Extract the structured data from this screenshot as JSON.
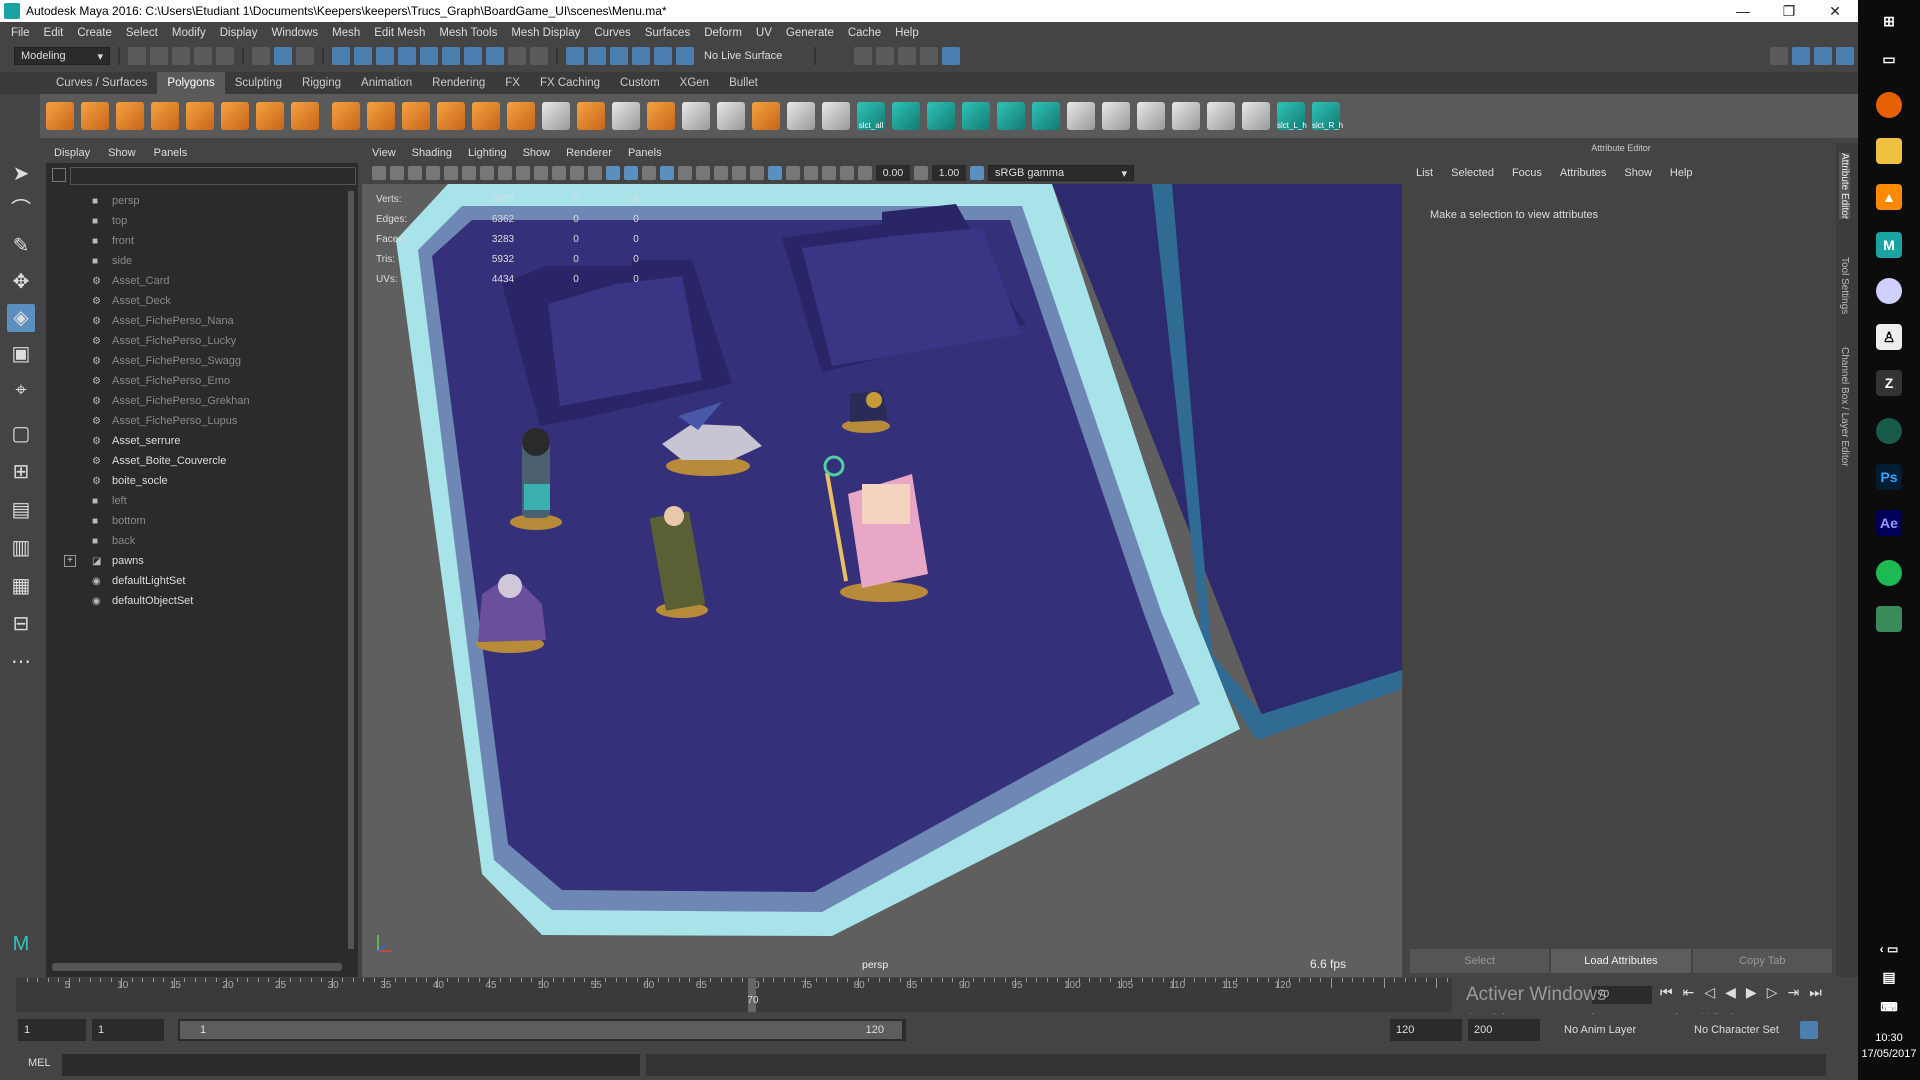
{
  "window": {
    "title": "Autodesk Maya 2016: C:\\Users\\Etudiant 1\\Documents\\Keepers\\keepers\\Trucs_Graph\\BoardGame_UI\\scenes\\Menu.ma*",
    "minimize": "—",
    "maximize": "❐",
    "close": "✕"
  },
  "menubar": [
    "File",
    "Edit",
    "Create",
    "Select",
    "Modify",
    "Display",
    "Windows",
    "Mesh",
    "Edit Mesh",
    "Mesh Tools",
    "Mesh Display",
    "Curves",
    "Surfaces",
    "Deform",
    "UV",
    "Generate",
    "Cache",
    "Help"
  ],
  "statusline": {
    "mode": "Modeling",
    "live_surface": "No Live Surface"
  },
  "shelf": {
    "tabs": [
      "Curves / Surfaces",
      "Polygons",
      "Sculpting",
      "Rigging",
      "Animation",
      "Rendering",
      "FX",
      "FX Caching",
      "Custom",
      "XGen",
      "Bullet"
    ],
    "active_tab": "Polygons",
    "custom_labels": [
      "slct_all",
      "slct_L_h",
      "slct_R_h"
    ]
  },
  "outliner": {
    "menu": [
      "Display",
      "Show",
      "Panels"
    ],
    "items": [
      {
        "label": "persp",
        "icon": "camera-icon",
        "dim": true
      },
      {
        "label": "top",
        "icon": "camera-icon",
        "dim": true
      },
      {
        "label": "front",
        "icon": "camera-icon",
        "dim": true
      },
      {
        "label": "side",
        "icon": "camera-icon",
        "dim": true
      },
      {
        "label": "Asset_Card",
        "icon": "group-icon",
        "dim": true
      },
      {
        "label": "Asset_Deck",
        "icon": "group-icon",
        "dim": true
      },
      {
        "label": "Asset_FichePerso_Nana",
        "icon": "group-icon",
        "dim": true
      },
      {
        "label": "Asset_FichePerso_Lucky",
        "icon": "group-icon",
        "dim": true
      },
      {
        "label": "Asset_FichePerso_Swagg",
        "icon": "group-icon",
        "dim": true
      },
      {
        "label": "Asset_FichePerso_Emo",
        "icon": "group-icon",
        "dim": true
      },
      {
        "label": "Asset_FichePerso_Grekhan",
        "icon": "group-icon",
        "dim": true
      },
      {
        "label": "Asset_FichePerso_Lupus",
        "icon": "group-icon",
        "dim": true
      },
      {
        "label": "Asset_serrure",
        "icon": "group-icon",
        "dim": false
      },
      {
        "label": "Asset_Boite_Couvercle",
        "icon": "group-icon",
        "dim": false
      },
      {
        "label": "boite_socle",
        "icon": "group-icon",
        "dim": false
      },
      {
        "label": "left",
        "icon": "camera-icon",
        "dim": true
      },
      {
        "label": "bottom",
        "icon": "camera-icon",
        "dim": true
      },
      {
        "label": "back",
        "icon": "camera-icon",
        "dim": true
      },
      {
        "label": "pawns",
        "icon": "layer-icon",
        "dim": false,
        "expandable": true
      },
      {
        "label": "defaultLightSet",
        "icon": "set-icon",
        "dim": false
      },
      {
        "label": "defaultObjectSet",
        "icon": "set-icon",
        "dim": false
      }
    ]
  },
  "viewport": {
    "menu": [
      "View",
      "Shading",
      "Lighting",
      "Show",
      "Renderer",
      "Panels"
    ],
    "exposure": "0.00",
    "gamma": "1.00",
    "color_space": "sRGB gamma",
    "camera": "persp",
    "fps": "6.6 fps",
    "hud": [
      {
        "label": "Verts:",
        "v1": "3070",
        "v2": "0",
        "v3": "0"
      },
      {
        "label": "Edges:",
        "v1": "6362",
        "v2": "0",
        "v3": "0"
      },
      {
        "label": "Faces:",
        "v1": "3283",
        "v2": "0",
        "v3": "0"
      },
      {
        "label": "Tris:",
        "v1": "5932",
        "v2": "0",
        "v3": "0"
      },
      {
        "label": "UVs:",
        "v1": "4434",
        "v2": "0",
        "v3": "0"
      }
    ],
    "colors": {
      "tray": "#35307a",
      "rim": "#a8e3ea",
      "background": "#5f5f5f"
    }
  },
  "attribute_editor": {
    "header": "Attribute Editor",
    "menu": [
      "List",
      "Selected",
      "Focus",
      "Attributes",
      "Show",
      "Help"
    ],
    "message": "Make a selection to view attributes",
    "buttons": [
      "Select",
      "Load Attributes",
      "Copy Tab"
    ],
    "side_tabs": [
      "Attribute Editor",
      "Tool Settings",
      "Channel Box / Layer Editor"
    ]
  },
  "timeline": {
    "ticks": [
      "5",
      "10",
      "15",
      "20",
      "25",
      "30",
      "35",
      "40",
      "45",
      "50",
      "55",
      "60",
      "65",
      "70",
      "75",
      "80",
      "85",
      "90",
      "95",
      "100",
      "105",
      "110",
      "115",
      "120"
    ],
    "current_frame": "70",
    "frame_field": "70"
  },
  "range": {
    "start": "1",
    "playback_start": "1",
    "range_start": "1",
    "range_end": "120",
    "playback_end": "120",
    "end": "200",
    "anim_layer": "No Anim Layer",
    "character_set": "No Character Set"
  },
  "command_line": {
    "label": "MEL"
  },
  "watermark": {
    "line1": "Activer Windows",
    "line2": "Accédez aux paramètres pour activer Windows."
  },
  "taskbar": {
    "time": "10:30",
    "date": "17/05/2017"
  }
}
